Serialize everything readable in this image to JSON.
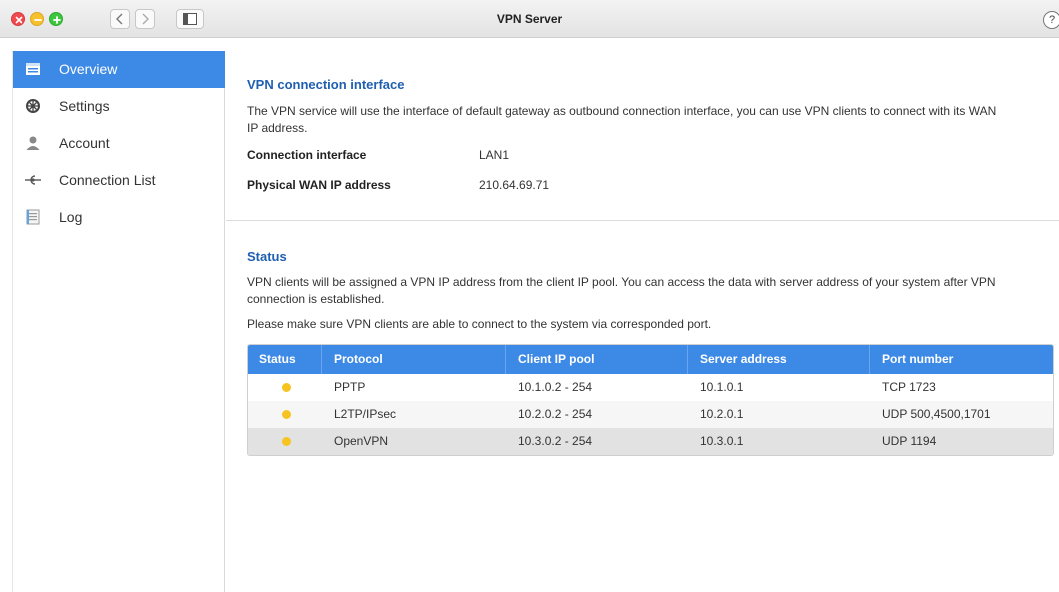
{
  "window": {
    "title": "VPN Server",
    "help": "?"
  },
  "colors": {
    "accent": "#3d8ae6",
    "heading": "#1f5fb0",
    "status_dot": "#f6c321"
  },
  "sidebar": {
    "items": [
      {
        "label": "Overview",
        "icon": "overview-icon",
        "active": true
      },
      {
        "label": "Settings",
        "icon": "settings-icon",
        "active": false
      },
      {
        "label": "Account",
        "icon": "account-icon",
        "active": false
      },
      {
        "label": "Connection List",
        "icon": "connection-icon",
        "active": false
      },
      {
        "label": "Log",
        "icon": "log-icon",
        "active": false
      }
    ]
  },
  "interface_section": {
    "title": "VPN connection interface",
    "description_line1": "The VPN service will use the interface of default gateway as outbound connection interface, you can use VPN clients to connect with its WAN",
    "description_line2": "IP address.",
    "connection_interface_label": "Connection interface",
    "connection_interface_value": "LAN1",
    "wan_ip_label": "Physical WAN IP address",
    "wan_ip_value": "210.64.69.71"
  },
  "status_section": {
    "title": "Status",
    "description_line1": "VPN clients will be assigned a VPN IP address from the client IP pool. You can access the data with server address of your system after VPN",
    "description_line2": "connection is established.",
    "note": "Please make sure VPN clients are able to connect to the system via corresponded port."
  },
  "table": {
    "headers": [
      "Status",
      "Protocol",
      "Client IP pool",
      "Server address",
      "Port number"
    ],
    "rows": [
      {
        "protocol": "PPTP",
        "pool": "10.1.0.2 - 254",
        "server": "10.1.0.1",
        "port": "TCP 1723"
      },
      {
        "protocol": "L2TP/IPsec",
        "pool": "10.2.0.2 - 254",
        "server": "10.2.0.1",
        "port": "UDP 500,4500,1701"
      },
      {
        "protocol": "OpenVPN",
        "pool": "10.3.0.2 - 254",
        "server": "10.3.0.1",
        "port": "UDP 1194"
      }
    ]
  }
}
